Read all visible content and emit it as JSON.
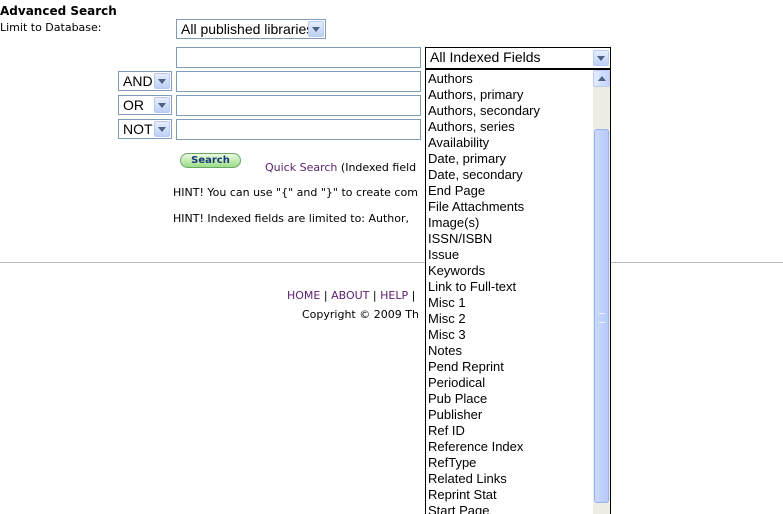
{
  "page": {
    "title": "Advanced Search",
    "limit_label": "Limit to Database:",
    "database_select": "All published libraries"
  },
  "form": {
    "row1_field": "All Indexed Fields",
    "row2_op": "AND",
    "row3_op": "OR",
    "row4_op": "NOT",
    "search_button": "Search",
    "quick_search_link": "Quick Search",
    "quick_search_rest": "(Indexed field",
    "hint1": "HINT! You can use \"{\" and \"}\" to create com",
    "hint2": "HINT! Indexed fields are limited to: Author,"
  },
  "footer": {
    "home": "HOME",
    "about": "ABOUT",
    "help": "HELP",
    "sep": "|",
    "copyright": "Copyright © 2009 Th"
  },
  "dropdown": {
    "items": [
      "Authors",
      "Authors, primary",
      "Authors, secondary",
      "Authors, series",
      "Availability",
      "Date, primary",
      "Date, secondary",
      "End Page",
      "File Attachments",
      "Image(s)",
      "ISSN/ISBN",
      "Issue",
      "Keywords",
      "Link to Full-text",
      "Misc 1",
      "Misc 2",
      "Misc 3",
      "Notes",
      "Pend Reprint",
      "Periodical",
      "Pub Place",
      "Publisher",
      "Ref ID",
      "Reference Index",
      "RefType",
      "Related Links",
      "Reprint Stat",
      "Start Page"
    ]
  }
}
